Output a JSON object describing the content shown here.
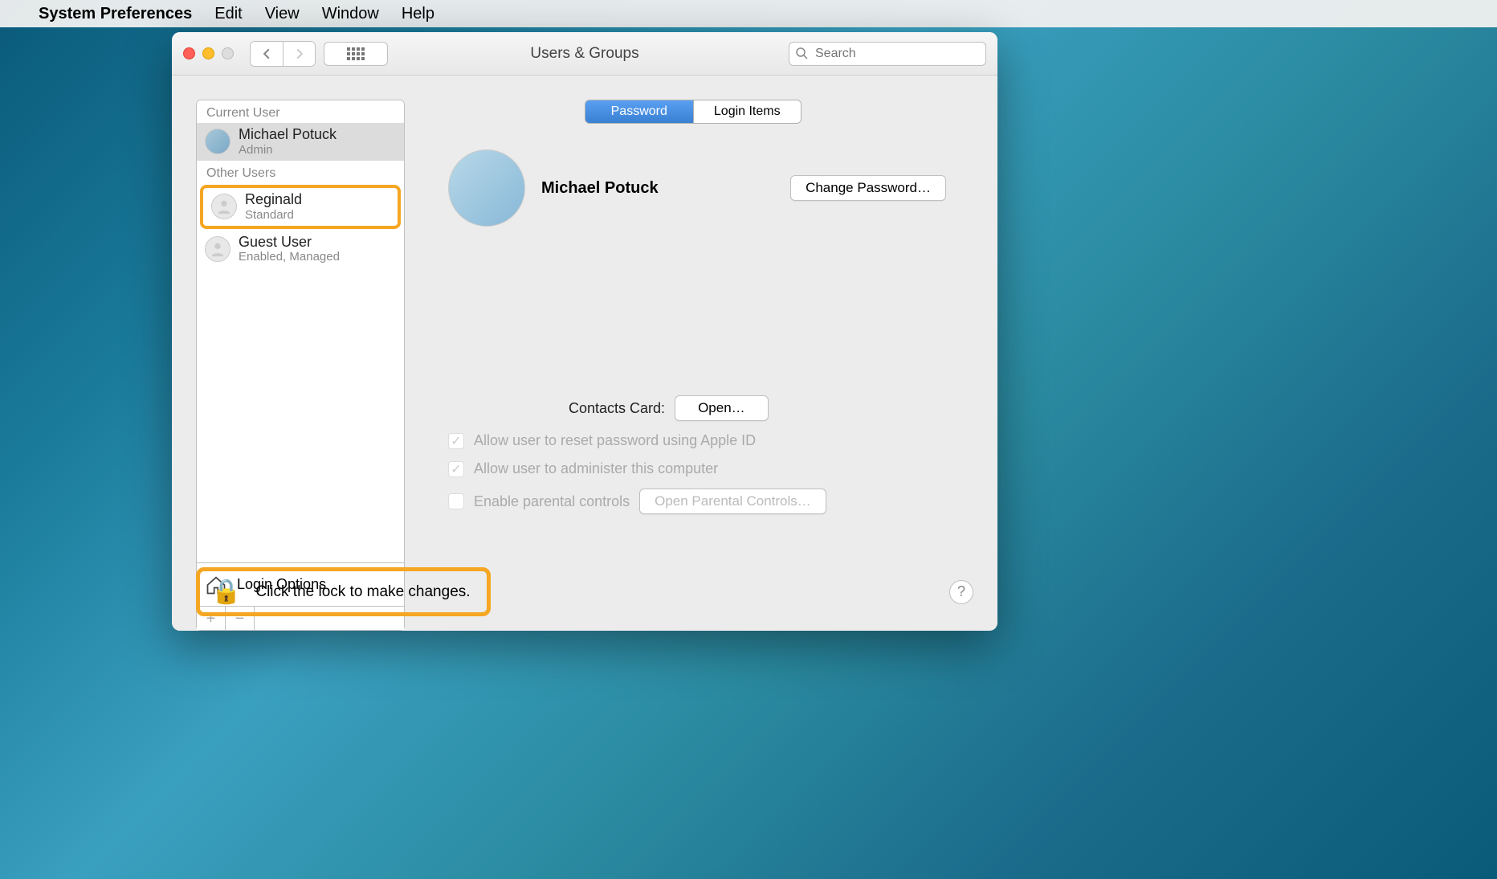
{
  "menubar": {
    "app_name": "System Preferences",
    "items": [
      "Edit",
      "View",
      "Window",
      "Help"
    ]
  },
  "window": {
    "title": "Users & Groups",
    "search_placeholder": "Search"
  },
  "sidebar": {
    "current_user_header": "Current User",
    "other_users_header": "Other Users",
    "current_user": {
      "name": "Michael Potuck",
      "role": "Admin"
    },
    "other_users": [
      {
        "name": "Reginald",
        "role": "Standard",
        "highlighted": true
      },
      {
        "name": "Guest User",
        "role": "Enabled, Managed"
      }
    ],
    "login_options": "Login Options"
  },
  "tabs": {
    "password": "Password",
    "login_items": "Login Items",
    "active": "password"
  },
  "main": {
    "user_name": "Michael Potuck",
    "change_password": "Change Password…",
    "contacts_label": "Contacts Card:",
    "open": "Open…",
    "allow_reset": "Allow user to reset password using Apple ID",
    "allow_admin": "Allow user to administer this computer",
    "enable_parental": "Enable parental controls",
    "open_parental": "Open Parental Controls…",
    "allow_reset_checked": true,
    "allow_admin_checked": true,
    "enable_parental_checked": false
  },
  "footer": {
    "lock_text": "Click the lock to make changes."
  }
}
